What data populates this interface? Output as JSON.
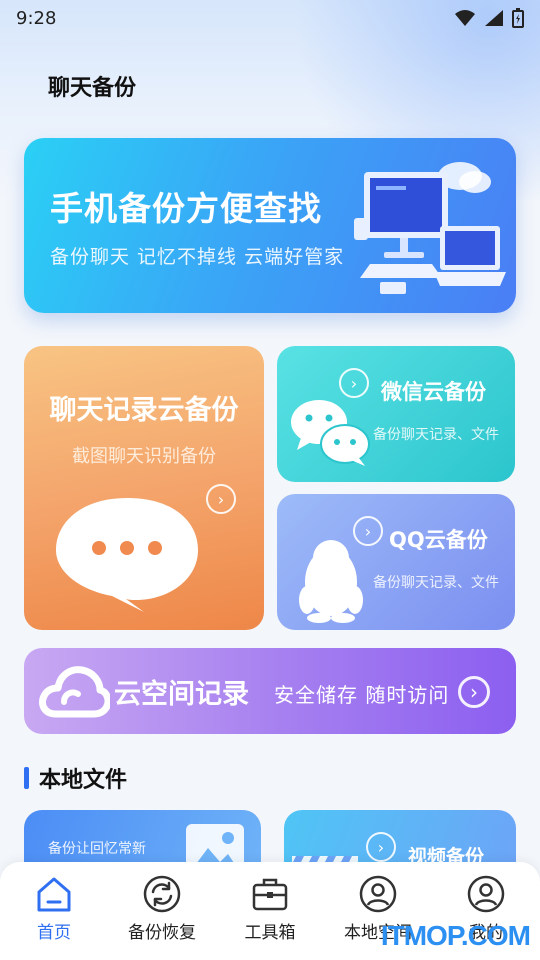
{
  "status_bar": {
    "time": "9:28"
  },
  "header": {
    "title": "聊天备份"
  },
  "hero": {
    "title": "手机备份方便查找",
    "subtitle": "备份聊天 记忆不掉线 云端好管家"
  },
  "cards": {
    "chat_record": {
      "title": "聊天记录云备份",
      "subtitle": "截图聊天识别备份"
    },
    "wechat": {
      "title": "微信云备份",
      "subtitle": "备份聊天记录、文件"
    },
    "qq": {
      "title": "QQ云备份",
      "subtitle": "备份聊天记录、文件"
    },
    "cloud_space": {
      "title": "云空间记录",
      "subtitle": "安全储存 随时访问"
    }
  },
  "local_files": {
    "section_title": "本地文件",
    "photo_card": {
      "subtitle": "备份让回忆常新"
    },
    "video_card": {
      "title": "视频备份"
    }
  },
  "tabbar": {
    "items": [
      {
        "label": "首页",
        "icon": "home-icon",
        "active": true
      },
      {
        "label": "备份恢复",
        "icon": "sync-icon",
        "active": false
      },
      {
        "label": "工具箱",
        "icon": "toolbox-icon",
        "active": false
      },
      {
        "label": "本地空间",
        "icon": "user-icon",
        "active": false
      },
      {
        "label": "我的",
        "icon": "profile-icon",
        "active": false
      }
    ]
  },
  "watermark": {
    "text": "ITMOP.COM"
  },
  "colors": {
    "accent": "#2f6ff2"
  }
}
